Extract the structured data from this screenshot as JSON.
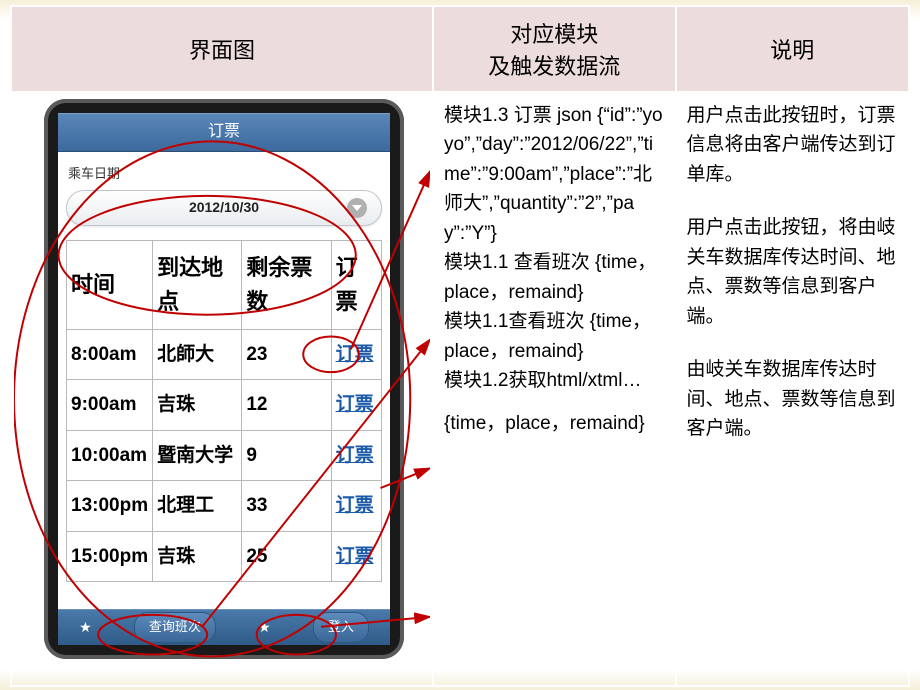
{
  "headers": {
    "left": "界面图",
    "mid_line1": "对应模块",
    "mid_line2": "及触发数据流",
    "right": "说明"
  },
  "phone": {
    "title": "订票",
    "ride_date_label": "乘车日期",
    "date_value": "2012/10/30",
    "columns": {
      "time": "时间",
      "dest": "到达地点",
      "remain": "剩余票数",
      "book": "订票"
    },
    "rows": [
      {
        "time": "8:00am",
        "dest": "北師大",
        "remain": "23",
        "book": "订票"
      },
      {
        "time": "9:00am",
        "dest": "吉珠",
        "remain": "12",
        "book": "订票"
      },
      {
        "time": "10:00am",
        "dest": "暨南大学",
        "remain": "9",
        "book": "订票"
      },
      {
        "time": "13:00pm",
        "dest": "北理工",
        "remain": "33",
        "book": "订票"
      },
      {
        "time": "15:00pm",
        "dest": "吉珠",
        "remain": "25",
        "book": "订票"
      }
    ],
    "bottom": {
      "query": "查询班次",
      "login": "登入"
    }
  },
  "modules": {
    "m1": "模块1.3 订票 json {“id”:”yoyo”,”day”:”2012/06/22”,”time”:”9:00am”,”place”:”北师大”,”quantity”:”2”,”pay”:”Y”}",
    "m2": "模块1.1 查看班次 {time，place，remaind}",
    "m3": "模块1.1查看班次 {time，place，remaind}",
    "m4a": "模块1.2获取html/xtml…",
    "m4b": "{time，place，remaind}"
  },
  "desc": {
    "d1": "用户点击此按钮时，订票信息将由客户端传达到订单库。",
    "d2": "用户点击此按钮，将由岐关车数据库传达时间、地点、票数等信息到客户端。",
    "d3": "由岐关车数据库传达时间、地点、票数等信息到客户端。"
  }
}
